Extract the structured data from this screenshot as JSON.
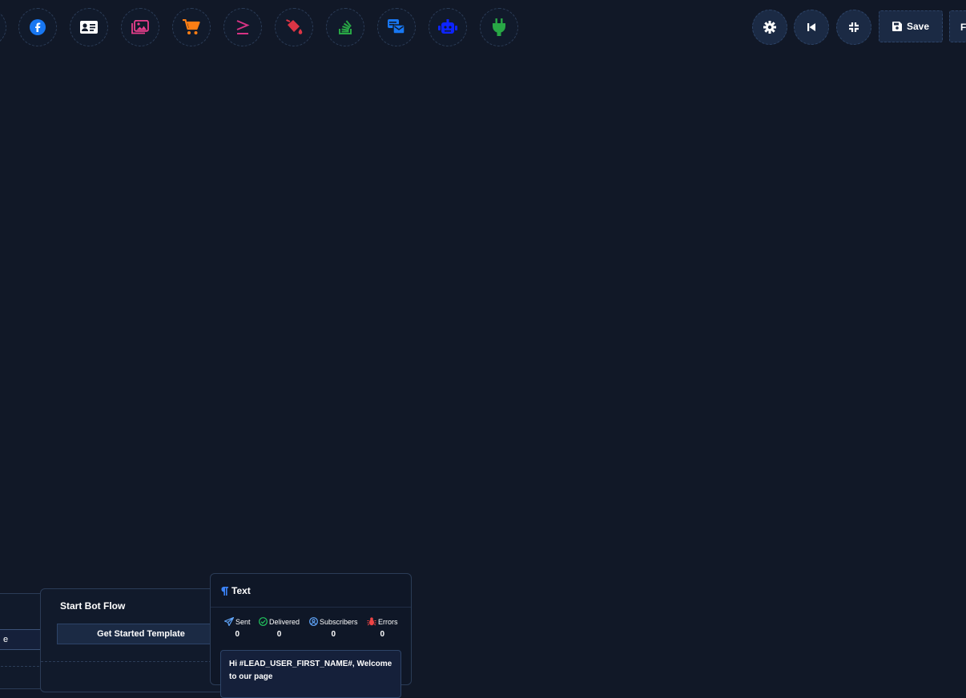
{
  "toolbar": {
    "icons": [
      {
        "name": "facebook-icon",
        "color": "#1877f2"
      },
      {
        "name": "contact-card-icon",
        "color": "#ffffff"
      },
      {
        "name": "images-icon",
        "color": "#e83e8c"
      },
      {
        "name": "cart-icon",
        "color": "#fd7e14"
      },
      {
        "name": "greater-equal-icon",
        "color": "#d63384"
      },
      {
        "name": "paint-bucket-icon",
        "color": "#dc3545"
      },
      {
        "name": "stack-icon",
        "color": "#28a745"
      },
      {
        "name": "messages-icon",
        "color": "#1877f2"
      },
      {
        "name": "robot-icon",
        "color": "#0d24ff"
      },
      {
        "name": "plug-icon",
        "color": "#28a745"
      }
    ],
    "controls": {
      "settings_icon": "gear-icon",
      "back_icon": "skip-back-icon",
      "compress_icon": "compress-icon",
      "save_label": "Save",
      "next_label_cut": "F"
    }
  },
  "nodes": {
    "left_partial": {
      "field_value": "e"
    },
    "start_flow": {
      "title": "Start Bot Flow",
      "button_label": "Get Started Template"
    },
    "text_node": {
      "title": "Text",
      "stats": [
        {
          "label": "Sent",
          "value": "0",
          "icon": "paper-plane-icon",
          "color": "#60a5fa"
        },
        {
          "label": "Delivered",
          "value": "0",
          "icon": "check-circle-icon",
          "color": "#22c55e"
        },
        {
          "label": "Subscribers",
          "value": "0",
          "icon": "user-circle-icon",
          "color": "#60a5fa"
        },
        {
          "label": "Errors",
          "value": "0",
          "icon": "bug-icon",
          "color": "#ef4444"
        }
      ],
      "message": "Hi #LEAD_USER_FIRST_NAME#, Welcome to our page"
    }
  },
  "colors": {
    "canvas": "#111827",
    "accent": "#1b2a44"
  }
}
